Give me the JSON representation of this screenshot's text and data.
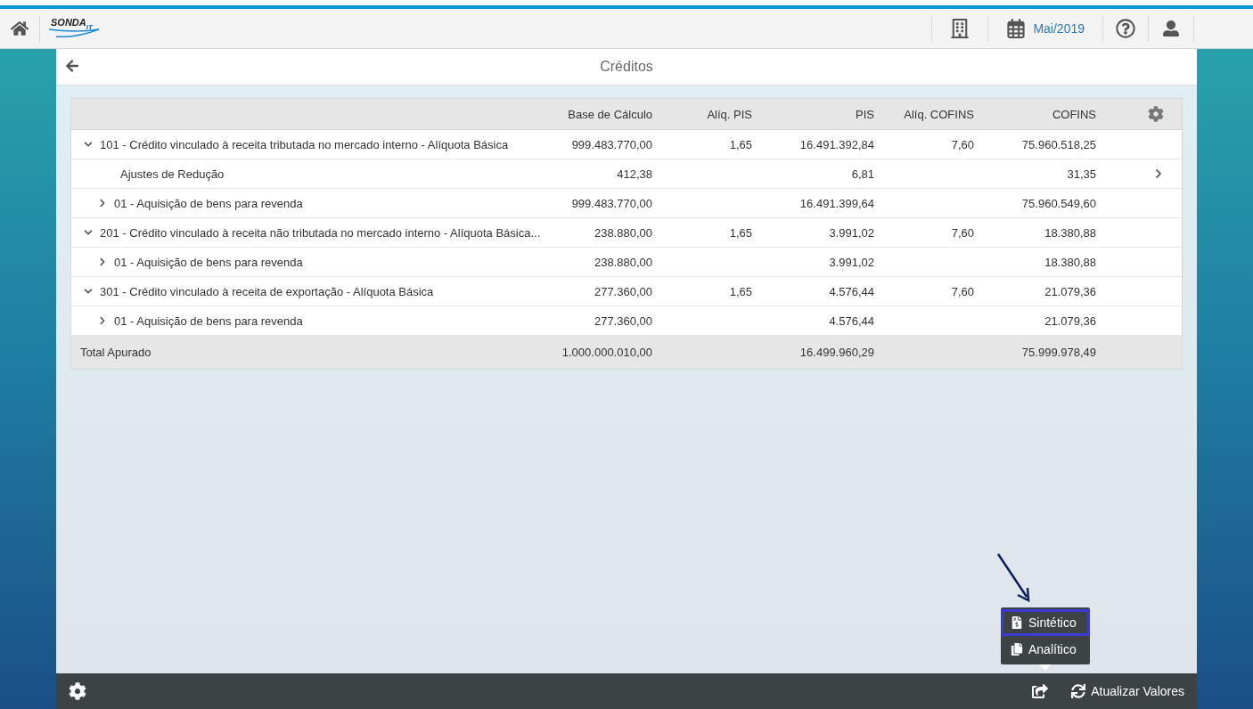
{
  "header": {
    "logo": {
      "name": "SONDA",
      "suffix": "IT"
    },
    "period": "Mai/2019"
  },
  "page": {
    "title": "Créditos"
  },
  "table": {
    "columns": {
      "base": "Base de Cálculo",
      "aliq_pis": "Alíq. PIS",
      "pis": "PIS",
      "aliq_cofins": "Alíq. COFINS",
      "cofins": "COFINS"
    },
    "rows": [
      {
        "kind": "group",
        "label": "101 - Crédito vinculado à receita tributada no mercado interno - Alíquota Básica",
        "base": "999.483.770,00",
        "aliq_pis": "1,65",
        "pis": "16.491.392,84",
        "aliq_cofins": "7,60",
        "cofins": "75.960.518,25",
        "expanded": true,
        "children": [
          {
            "kind": "adjustment",
            "label": "Ajustes de Redução",
            "base": "412,38",
            "pis": "6,81",
            "cofins": "31,35"
          },
          {
            "kind": "group",
            "label": "01 - Aquisição de bens para revenda",
            "base": "999.483.770,00",
            "pis": "16.491.399,64",
            "cofins": "75.960.549,60",
            "expanded": false
          }
        ]
      },
      {
        "kind": "group",
        "label": "201 - Crédito vinculado à receita não tributada no mercado interno - Alíquota Básica...",
        "base": "238.880,00",
        "aliq_pis": "1,65",
        "pis": "3.991,02",
        "aliq_cofins": "7,60",
        "cofins": "18.380,88",
        "expanded": true,
        "children": [
          {
            "kind": "group",
            "label": "01 - Aquisição de bens para revenda",
            "base": "238.880,00",
            "pis": "3.991,02",
            "cofins": "18.380,88",
            "expanded": false
          }
        ]
      },
      {
        "kind": "group",
        "label": "301 - Crédito vinculado à receita de exportação - Alíquota Básica",
        "base": "277.360,00",
        "aliq_pis": "1,65",
        "pis": "4.576,44",
        "aliq_cofins": "7,60",
        "cofins": "21.079,36",
        "expanded": true,
        "children": [
          {
            "kind": "group",
            "label": "01 - Aquisição de bens para revenda",
            "base": "277.360,00",
            "pis": "4.576,44",
            "cofins": "21.079,36",
            "expanded": false
          }
        ]
      }
    ],
    "total": {
      "label": "Total Apurado",
      "base": "1.000.000.010,00",
      "pis": "16.499.960,29",
      "cofins": "75.999.978,49"
    }
  },
  "export_menu": [
    {
      "label": "Sintético",
      "highlighted": true
    },
    {
      "label": "Analítico",
      "highlighted": false
    }
  ],
  "footer": {
    "refresh": "Atualizar Valores"
  }
}
